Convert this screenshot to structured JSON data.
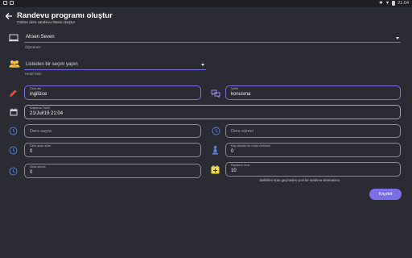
{
  "status_bar": {
    "time": "21:04"
  },
  "header": {
    "title": "Randevu programı oluştur",
    "subtitle": "Online ders randevu listesi oluştur"
  },
  "teacher": {
    "value": "Ahsen Seven",
    "label": "Öğretmen"
  },
  "target": {
    "placeholder": "Listeden bir seçim yapın",
    "label": "Hedef kitle"
  },
  "fields": {
    "lesson_name": {
      "label": "Ders adı",
      "value": "ingilizce"
    },
    "topic": {
      "label": "İçerik",
      "value": "konusma"
    },
    "start_date": {
      "label": "Başlama Tarihi",
      "value": "21/Jul/19 21:04"
    },
    "lesson_count": {
      "placeholder": "Ders sayısı"
    },
    "lesson_duration": {
      "placeholder": "Ders süresi"
    },
    "between_lessons": {
      "label": "Ders arası süre",
      "value": "0"
    },
    "break_after": {
      "label": "Kaç dersde bir mola verilmeli",
      "value": "0"
    },
    "break_duration": {
      "label": "Mola süresi",
      "value": "0"
    },
    "appointment_block": {
      "label": "Randevu blok",
      "value": "10"
    }
  },
  "note": "Belirtilen süre geçmeden yeni bir randevu alınmasına.",
  "save_button": "Kaydet",
  "colors": {
    "accent": "#7b6fe6",
    "background": "#2b2b33",
    "pencil": "#e2543a",
    "gold": "#f2c94c"
  }
}
